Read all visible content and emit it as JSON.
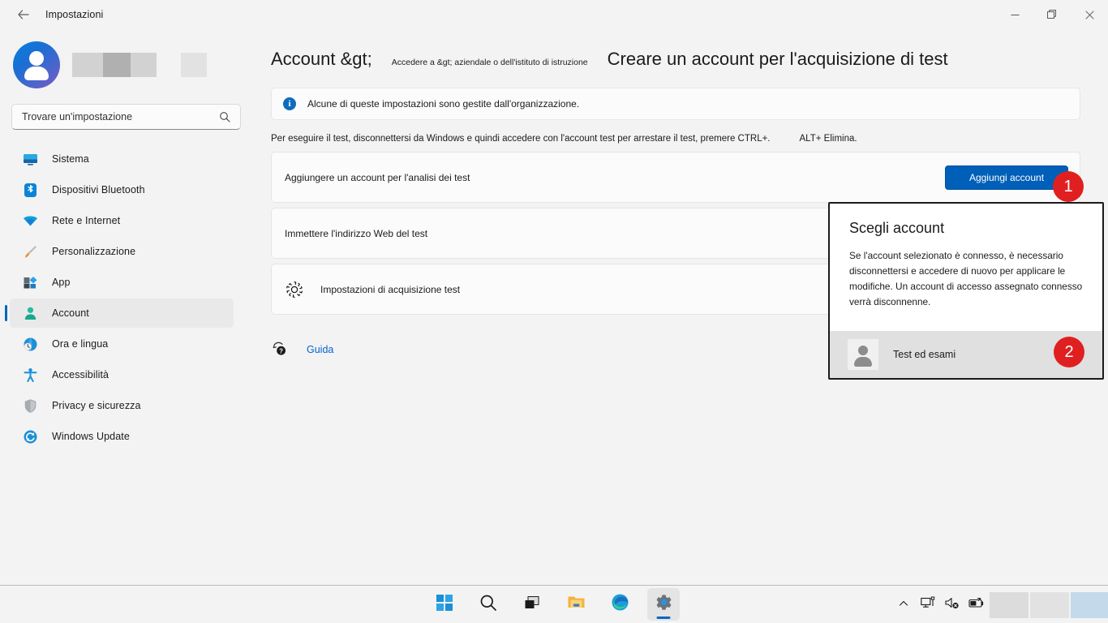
{
  "window": {
    "title": "Impostazioni",
    "back_icon": "back-arrow-icon",
    "minimize_label": "─",
    "maximize_label": "□",
    "close_label": "✕"
  },
  "sidebar": {
    "profile": {
      "avatar_icon": "user-avatar-icon",
      "name_redacted": true
    },
    "search": {
      "placeholder": "Trovare un'impostazione",
      "value": "",
      "icon": "search-icon"
    },
    "items": [
      {
        "label": "Sistema",
        "icon": "monitor-icon",
        "selected": false
      },
      {
        "label": "Dispositivi Bluetooth",
        "icon": "bluetooth-icon",
        "selected": false
      },
      {
        "label": "Rete e Internet",
        "icon": "wifi-icon",
        "selected": false
      },
      {
        "label": "Personalizzazione",
        "icon": "paintbrush-icon",
        "selected": false
      },
      {
        "label": "App",
        "icon": "apps-icon",
        "selected": false
      },
      {
        "label": "Account",
        "icon": "person-icon",
        "selected": true
      },
      {
        "label": "Ora e lingua",
        "icon": "clock-globe-icon",
        "selected": false
      },
      {
        "label": "Accessibilità",
        "icon": "accessibility-icon",
        "selected": false
      },
      {
        "label": "Privacy e sicurezza",
        "icon": "shield-icon",
        "selected": false
      },
      {
        "label": "Windows Update",
        "icon": "update-icon",
        "selected": false
      }
    ]
  },
  "breadcrumb": {
    "root": "Account &gt;",
    "middle": "Accedere a &gt; aziendale o dell'istituto di istruzione",
    "current": "Creare un account per l'acquisizione di test"
  },
  "info_banner": {
    "icon": "info-icon",
    "text": "Alcune di queste impostazioni sono gestite dall'organizzazione."
  },
  "description": {
    "part1": "Per eseguire il test, disconnettersi da Windows e quindi accedere con l'account test per arrestare il test, premere CTRL+.",
    "part2": "ALT+ Elimina."
  },
  "cards": [
    {
      "title": "Aggiungere un account per l'analisi dei test",
      "icon": null,
      "button": "Aggiungi account"
    },
    {
      "title": "Immettere l'indirizzo Web del test",
      "icon": null,
      "button": null
    },
    {
      "title": "Impostazioni di acquisizione test",
      "icon": "gear-icon",
      "button": null
    }
  ],
  "help": {
    "icon": "help-question-icon",
    "label": "Guida"
  },
  "flyout": {
    "title": "Scegli account",
    "body": "Se l'account selezionato è connesso, è necessario disconnettersi e accedere di nuovo per applicare le modifiche. Un account di accesso assegnato connesso verrà disconnenne.",
    "account": {
      "name": "Test ed esami",
      "avatar_icon": "contact-icon"
    }
  },
  "badges": [
    {
      "number": "1"
    },
    {
      "number": "2"
    }
  ],
  "taskbar": {
    "buttons": [
      {
        "icon": "windows-start-icon",
        "active": false
      },
      {
        "icon": "search-icon",
        "active": false
      },
      {
        "icon": "task-view-icon",
        "active": false
      },
      {
        "icon": "file-explorer-icon",
        "active": false
      },
      {
        "icon": "edge-browser-icon",
        "active": false
      },
      {
        "icon": "settings-gear-icon",
        "active": true
      }
    ],
    "tray": [
      {
        "icon": "chevron-up-icon"
      },
      {
        "icon": "network-monitor-icon"
      },
      {
        "icon": "speaker-muted-icon"
      },
      {
        "icon": "battery-icon"
      }
    ]
  },
  "colors": {
    "accent": "#005fb8",
    "selection_bar": "#0067c0",
    "badge_red": "#e02020",
    "link_blue": "#0066cc",
    "page_bg": "#f3f3f3",
    "card_bg": "#fbfbfb"
  }
}
